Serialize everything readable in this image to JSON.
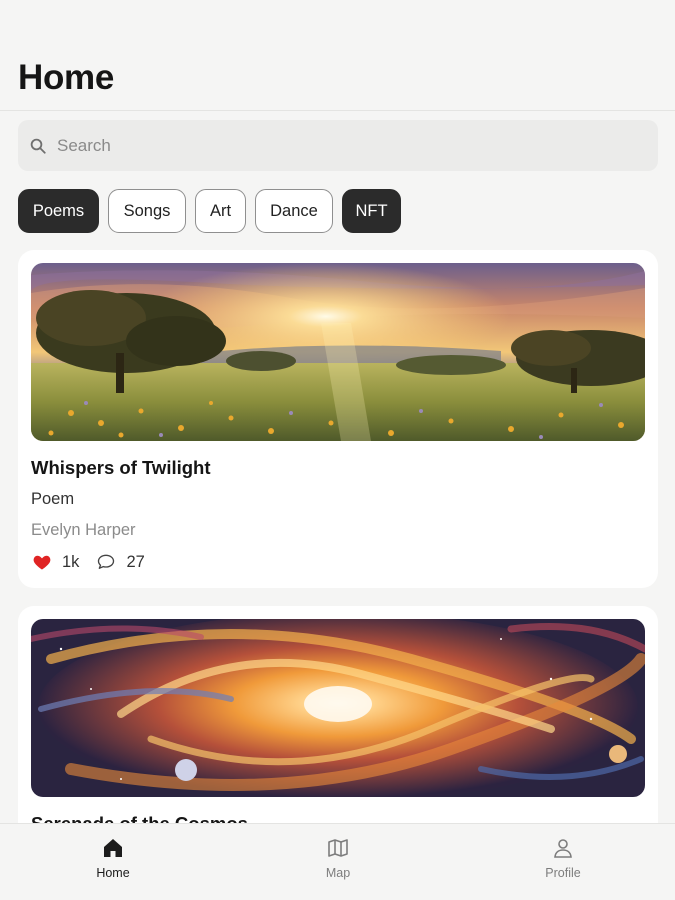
{
  "header": {
    "title": "Home"
  },
  "search": {
    "placeholder": "Search",
    "icon": "search-icon"
  },
  "categories": [
    {
      "label": "Poems",
      "active": true
    },
    {
      "label": "Songs",
      "active": false
    },
    {
      "label": "Art",
      "active": false
    },
    {
      "label": "Dance",
      "active": false
    },
    {
      "label": "NFT",
      "active": true
    }
  ],
  "feed": [
    {
      "title": "Whispers of Twilight",
      "type": "Poem",
      "author": "Evelyn Harper",
      "likes": "1k",
      "comments": "27",
      "image": "sunset-meadow-painting"
    },
    {
      "title": "Serenade of the Cosmos",
      "image": "galaxy-swirl-painting"
    }
  ],
  "tabbar": [
    {
      "label": "Home",
      "icon": "home-icon",
      "active": true
    },
    {
      "label": "Map",
      "icon": "map-icon",
      "active": false
    },
    {
      "label": "Profile",
      "icon": "profile-icon",
      "active": false
    }
  ],
  "colors": {
    "accent": "#2b2b2b",
    "like": "#e02424",
    "background": "#f5f5f4"
  }
}
